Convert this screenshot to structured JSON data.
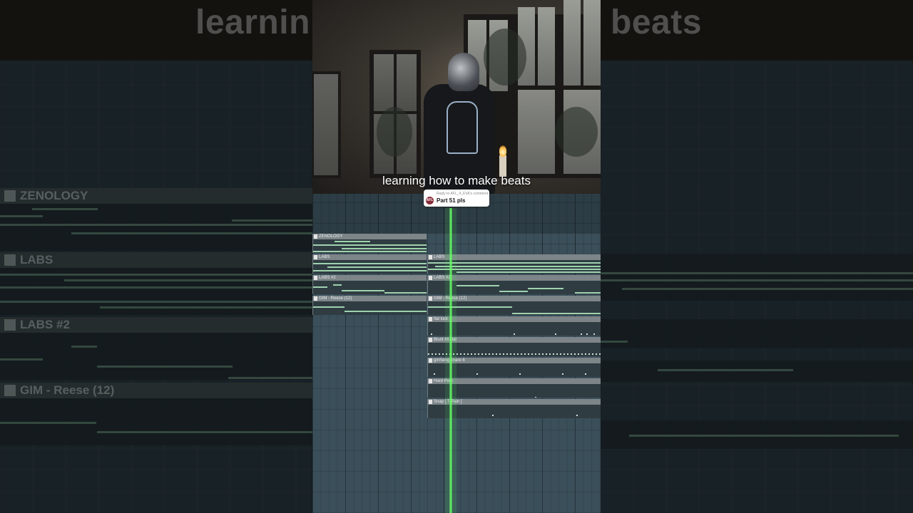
{
  "video": {
    "caption": "learning how to make beats",
    "reply": {
      "meta": "Reply to AFL_4_EVA's comment",
      "avatar_initials": "AFL",
      "text": "Part 51 pls"
    }
  },
  "backdrop": {
    "left_title": "learnin",
    "right_title": "beats",
    "lanes": [
      "ZENOLOGY",
      "LABS",
      "LABS #2",
      "GIM - Reese (12)"
    ]
  },
  "playlist": {
    "tracks_left": [
      {
        "label": "ZENOLOGY"
      },
      {
        "label": "LABS"
      },
      {
        "label": "LABS #2"
      },
      {
        "label": "GIM - Reese (12)"
      }
    ],
    "tracks_right": [
      {
        "label": "LABS"
      },
      {
        "label": "LABS #2"
      },
      {
        "label": "GIM - Reese (12)"
      },
      {
        "label": "flat kick"
      },
      {
        "label": "Blunt Hi Hat"
      },
      {
        "label": "ginSeng snare 8"
      },
      {
        "label": "Hard Perc"
      },
      {
        "label": "Snap [ T-Pain ]"
      }
    ]
  },
  "colors": {
    "playhead": "#63ff63",
    "note": "#9fd3ae",
    "clip_header": "#7d8589",
    "grid_bg": "#3b4f5a"
  }
}
